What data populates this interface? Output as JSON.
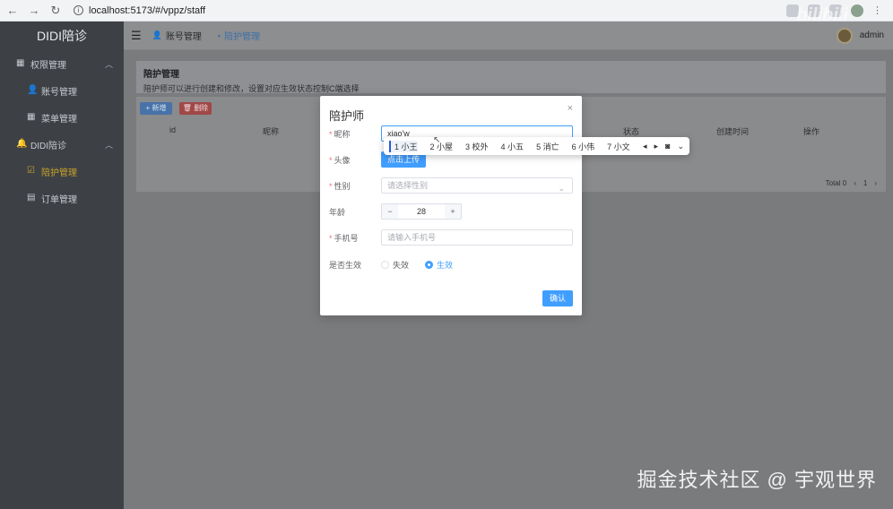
{
  "browser": {
    "url": "localhost:5173/#/vppz/staff"
  },
  "sidebar": {
    "logo": "DIDI陪诊",
    "groups": [
      {
        "label": "权限管理",
        "items": [
          {
            "label": "账号管理"
          },
          {
            "label": "菜单管理"
          }
        ]
      },
      {
        "label": "DIDI陪诊",
        "items": [
          {
            "label": "陪护管理"
          },
          {
            "label": "订单管理"
          }
        ]
      }
    ]
  },
  "topbar": {
    "tabs": [
      {
        "label": "账号管理"
      },
      {
        "label": "陪护管理"
      }
    ],
    "username": "admin"
  },
  "page": {
    "title": "陪护管理",
    "description": "陪护师可以进行创建和修改，设置对应生效状态控制C端选择",
    "add_label": "+ 新增",
    "delete_label": "删除",
    "columns": [
      "id",
      "昵称",
      "状态",
      "创建时间",
      "操作"
    ],
    "total": "Total 0",
    "page_num": "1"
  },
  "modal": {
    "title": "陪护师",
    "nickname_label": "昵称",
    "nickname_value": "xiao'w",
    "avatar_label": "头像",
    "upload_label": "点击上传",
    "gender_label": "性别",
    "gender_placeholder": "请选择性别",
    "age_label": "年龄",
    "age_value": "28",
    "phone_label": "手机号",
    "phone_placeholder": "请输入手机号",
    "active_label": "是否生效",
    "inactive_option": "失效",
    "active_option": "生效",
    "confirm_label": "确认"
  },
  "ime": {
    "candidates": [
      "1 小王",
      "2 小屋",
      "3 校外",
      "4 小五",
      "5 消亡",
      "6 小伟",
      "7 小文"
    ]
  },
  "watermark": "掘金技术社区 @ 宇观世界",
  "colors": {
    "primary": "#409eff",
    "sidebar": "#3d4146"
  }
}
